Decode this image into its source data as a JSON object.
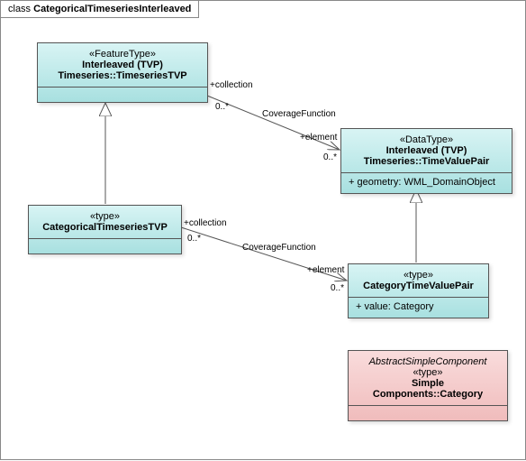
{
  "diagram": {
    "title_prefix": "class ",
    "title": "CategoricalTimeseriesInterleaved"
  },
  "classes": {
    "timeseriesTVP": {
      "stereotype": "«FeatureType»",
      "name": "Interleaved (TVP) Timeseries::TimeseriesTVP"
    },
    "categoricalTimeseriesTVP": {
      "stereotype": "«type»",
      "name": "CategoricalTimeseriesTVP"
    },
    "timeValuePair": {
      "stereotype": "«DataType»",
      "name": "Interleaved (TVP) Timeseries::TimeValuePair",
      "attr1": "+   geometry: WML_DomainObject"
    },
    "categoryTimeValuePair": {
      "stereotype": "«type»",
      "name": "CategoryTimeValuePair",
      "attr1": "+   value: Category"
    },
    "simpleCategory": {
      "top_label": "AbstractSimpleComponent",
      "stereotype": "«type»",
      "name": "Simple Components::Category"
    }
  },
  "assoc": {
    "a1": {
      "name": "CoverageFunction",
      "role_collection": "+collection",
      "mult_collection": "0..*",
      "role_element": "+element",
      "mult_element": "0..*"
    },
    "a2": {
      "name": "CoverageFunction",
      "role_collection": "+collection",
      "mult_collection": "0..*",
      "role_element": "+element",
      "mult_element": "0..*"
    }
  }
}
